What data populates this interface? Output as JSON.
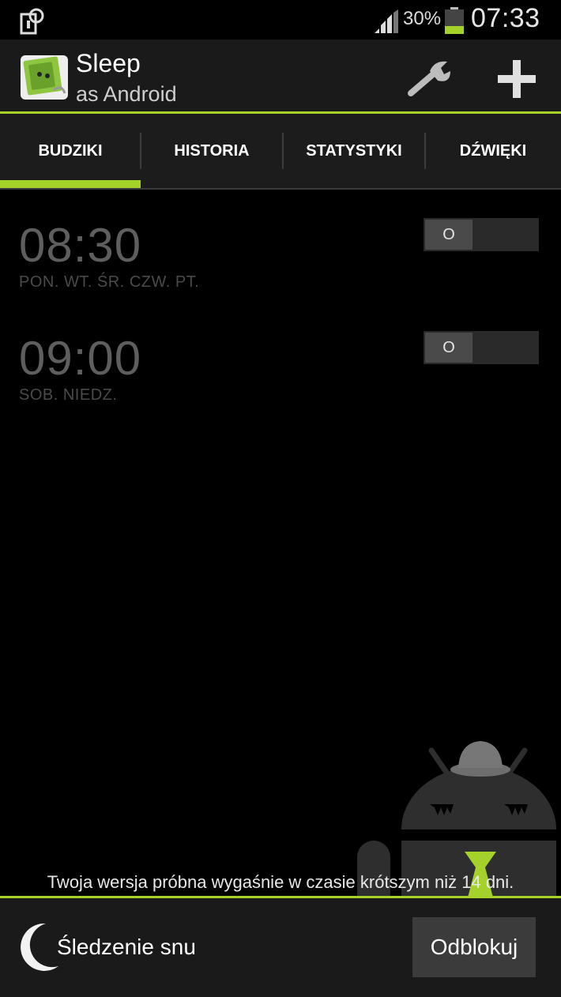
{
  "status_bar": {
    "battery_percent": "30%",
    "battery_level": 0.3,
    "time": "07:33",
    "icons": [
      "nfc-tag-icon",
      "signal-icon",
      "battery-icon"
    ]
  },
  "action_bar": {
    "title": "Sleep",
    "subtitle": "as Android",
    "icons": [
      "app-logo-icon",
      "wrench-icon",
      "plus-icon"
    ]
  },
  "tabs": [
    {
      "label": "BUDZIKI",
      "selected": true
    },
    {
      "label": "HISTORIA",
      "selected": false
    },
    {
      "label": "STATYSTYKI",
      "selected": false
    },
    {
      "label": "DŹWIĘKI",
      "selected": false
    }
  ],
  "alarms": [
    {
      "time": "08:30",
      "days": "PON. WT. ŚR. CZW. PT.",
      "toggle_label": "O",
      "enabled": false
    },
    {
      "time": "09:00",
      "days": "SOB. NIEDZ.",
      "toggle_label": "O",
      "enabled": false
    }
  ],
  "trial_notice": "Twoja wersja próbna wygaśnie w czasie krótszym niż 14 dni.",
  "bottom_bar": {
    "sleep_tracking_label": "Śledzenie snu",
    "unlock_label": "Odblokuj"
  },
  "colors": {
    "accent": "#a4d22a",
    "background": "#000000",
    "bar_background": "#1a1a1a"
  }
}
